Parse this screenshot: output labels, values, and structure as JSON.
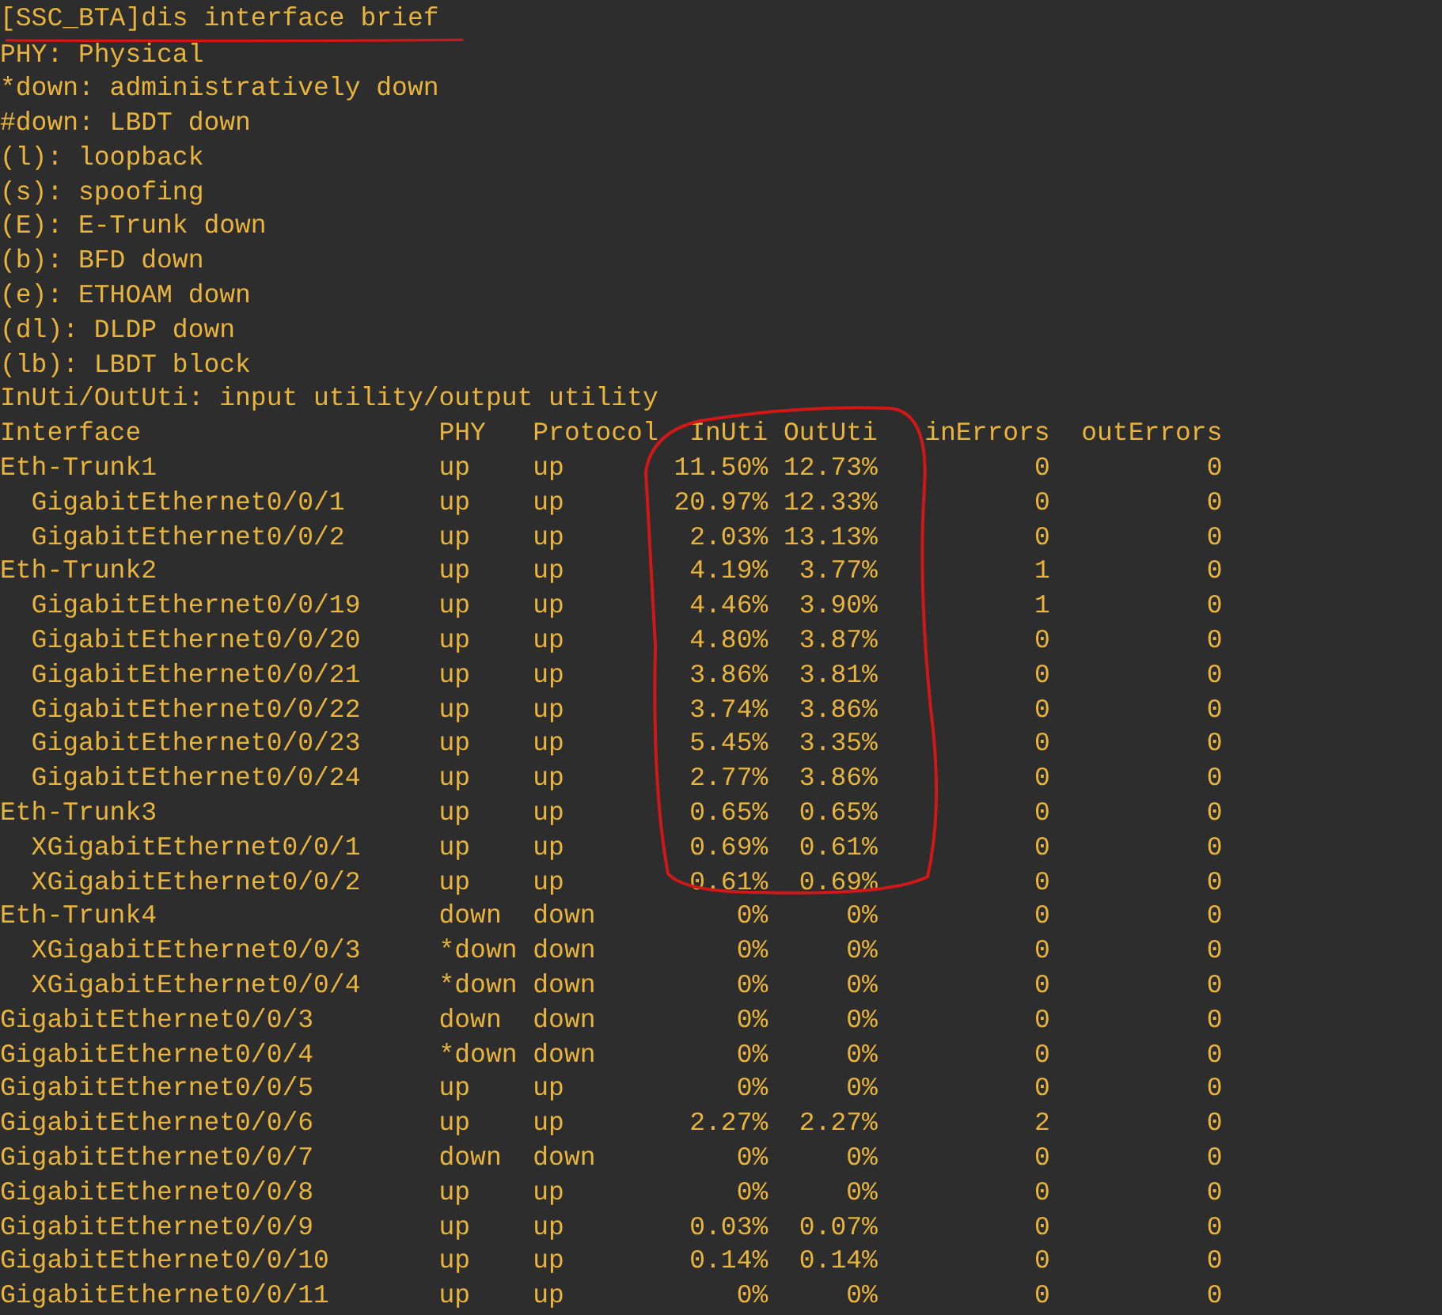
{
  "command": "[SSC_BTA]dis interface brief",
  "legend": [
    "PHY: Physical",
    "*down: administratively down",
    "#down: LBDT down",
    "(l): loopback",
    "(s): spoofing",
    "(E): E-Trunk down",
    "(b): BFD down",
    "(e): ETHOAM down",
    "(dl): DLDP down",
    "(lb): LBDT block",
    "InUti/OutUti: input utility/output utility"
  ],
  "table": {
    "columns": [
      "Interface",
      "PHY",
      "Protocol",
      "InUti",
      "OutUti",
      "inErrors",
      "outErrors"
    ],
    "rows": [
      {
        "interface": "Eth-Trunk1",
        "phy": "up",
        "protocol": "up",
        "in_uti": "11.50%",
        "out_uti": "12.73%",
        "in_errors": "0",
        "out_errors": "0",
        "children": [
          {
            "interface": "GigabitEthernet0/0/1",
            "phy": "up",
            "protocol": "up",
            "in_uti": "20.97%",
            "out_uti": "12.33%",
            "in_errors": "0",
            "out_errors": "0"
          },
          {
            "interface": "GigabitEthernet0/0/2",
            "phy": "up",
            "protocol": "up",
            "in_uti": "2.03%",
            "out_uti": "13.13%",
            "in_errors": "0",
            "out_errors": "0"
          }
        ]
      },
      {
        "interface": "Eth-Trunk2",
        "phy": "up",
        "protocol": "up",
        "in_uti": "4.19%",
        "out_uti": "3.77%",
        "in_errors": "1",
        "out_errors": "0",
        "children": [
          {
            "interface": "GigabitEthernet0/0/19",
            "phy": "up",
            "protocol": "up",
            "in_uti": "4.46%",
            "out_uti": "3.90%",
            "in_errors": "1",
            "out_errors": "0"
          },
          {
            "interface": "GigabitEthernet0/0/20",
            "phy": "up",
            "protocol": "up",
            "in_uti": "4.80%",
            "out_uti": "3.87%",
            "in_errors": "0",
            "out_errors": "0"
          },
          {
            "interface": "GigabitEthernet0/0/21",
            "phy": "up",
            "protocol": "up",
            "in_uti": "3.86%",
            "out_uti": "3.81%",
            "in_errors": "0",
            "out_errors": "0"
          },
          {
            "interface": "GigabitEthernet0/0/22",
            "phy": "up",
            "protocol": "up",
            "in_uti": "3.74%",
            "out_uti": "3.86%",
            "in_errors": "0",
            "out_errors": "0"
          },
          {
            "interface": "GigabitEthernet0/0/23",
            "phy": "up",
            "protocol": "up",
            "in_uti": "5.45%",
            "out_uti": "3.35%",
            "in_errors": "0",
            "out_errors": "0"
          },
          {
            "interface": "GigabitEthernet0/0/24",
            "phy": "up",
            "protocol": "up",
            "in_uti": "2.77%",
            "out_uti": "3.86%",
            "in_errors": "0",
            "out_errors": "0"
          }
        ]
      },
      {
        "interface": "Eth-Trunk3",
        "phy": "up",
        "protocol": "up",
        "in_uti": "0.65%",
        "out_uti": "0.65%",
        "in_errors": "0",
        "out_errors": "0",
        "children": [
          {
            "interface": "XGigabitEthernet0/0/1",
            "phy": "up",
            "protocol": "up",
            "in_uti": "0.69%",
            "out_uti": "0.61%",
            "in_errors": "0",
            "out_errors": "0"
          },
          {
            "interface": "XGigabitEthernet0/0/2",
            "phy": "up",
            "protocol": "up",
            "in_uti": "0.61%",
            "out_uti": "0.69%",
            "in_errors": "0",
            "out_errors": "0"
          }
        ]
      },
      {
        "interface": "Eth-Trunk4",
        "phy": "down",
        "protocol": "down",
        "in_uti": "0%",
        "out_uti": "0%",
        "in_errors": "0",
        "out_errors": "0",
        "children": [
          {
            "interface": "XGigabitEthernet0/0/3",
            "phy": "*down",
            "protocol": "down",
            "in_uti": "0%",
            "out_uti": "0%",
            "in_errors": "0",
            "out_errors": "0"
          },
          {
            "interface": "XGigabitEthernet0/0/4",
            "phy": "*down",
            "protocol": "down",
            "in_uti": "0%",
            "out_uti": "0%",
            "in_errors": "0",
            "out_errors": "0"
          }
        ]
      },
      {
        "interface": "GigabitEthernet0/0/3",
        "phy": "down",
        "protocol": "down",
        "in_uti": "0%",
        "out_uti": "0%",
        "in_errors": "0",
        "out_errors": "0"
      },
      {
        "interface": "GigabitEthernet0/0/4",
        "phy": "*down",
        "protocol": "down",
        "in_uti": "0%",
        "out_uti": "0%",
        "in_errors": "0",
        "out_errors": "0"
      },
      {
        "interface": "GigabitEthernet0/0/5",
        "phy": "up",
        "protocol": "up",
        "in_uti": "0%",
        "out_uti": "0%",
        "in_errors": "0",
        "out_errors": "0"
      },
      {
        "interface": "GigabitEthernet0/0/6",
        "phy": "up",
        "protocol": "up",
        "in_uti": "2.27%",
        "out_uti": "2.27%",
        "in_errors": "2",
        "out_errors": "0"
      },
      {
        "interface": "GigabitEthernet0/0/7",
        "phy": "down",
        "protocol": "down",
        "in_uti": "0%",
        "out_uti": "0%",
        "in_errors": "0",
        "out_errors": "0"
      },
      {
        "interface": "GigabitEthernet0/0/8",
        "phy": "up",
        "protocol": "up",
        "in_uti": "0%",
        "out_uti": "0%",
        "in_errors": "0",
        "out_errors": "0"
      },
      {
        "interface": "GigabitEthernet0/0/9",
        "phy": "up",
        "protocol": "up",
        "in_uti": "0.03%",
        "out_uti": "0.07%",
        "in_errors": "0",
        "out_errors": "0"
      },
      {
        "interface": "GigabitEthernet0/0/10",
        "phy": "up",
        "protocol": "up",
        "in_uti": "0.14%",
        "out_uti": "0.14%",
        "in_errors": "0",
        "out_errors": "0"
      },
      {
        "interface": "GigabitEthernet0/0/11",
        "phy": "up",
        "protocol": "up",
        "in_uti": "0%",
        "out_uti": "0%",
        "in_errors": "0",
        "out_errors": "0"
      }
    ]
  }
}
